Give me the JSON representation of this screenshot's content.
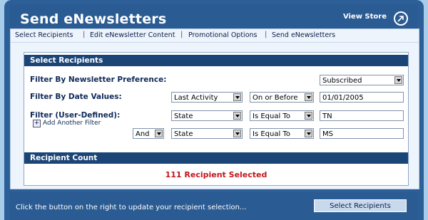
{
  "header": {
    "title": "Send eNewsletters",
    "view_store": "View Store"
  },
  "tabs": [
    "Select Recipients",
    "Edit eNewsletter Content",
    "Promotional Options",
    "Send eNewsletters"
  ],
  "select_recipients": {
    "heading": "Select Recipients",
    "newsletter_pref": {
      "label": "Filter By Newsletter Preference:",
      "value": "Subscribed"
    },
    "date_values": {
      "label": "Filter By Date Values:",
      "field": "Last Activity",
      "operator": "On or Before",
      "value": "01/01/2005"
    },
    "user_defined": {
      "label": "Filter (User-Defined):",
      "add_filter": "Add Another Filter",
      "row1": {
        "field": "State",
        "operator": "Is Equal To",
        "value": "TN"
      },
      "row2": {
        "conjunction": "And",
        "field": "State",
        "operator": "Is Equal To",
        "value": "MS"
      }
    }
  },
  "recipient_count": {
    "heading": "Recipient Count",
    "text": "111 Recipient Selected"
  },
  "footer": {
    "hint": "Click the button on the right to update your recipient selection...",
    "button": "Select Recipients"
  },
  "colors": {
    "accent": "#2c5f97",
    "count_text": "#c1171d",
    "section_header": "#1b4577"
  }
}
